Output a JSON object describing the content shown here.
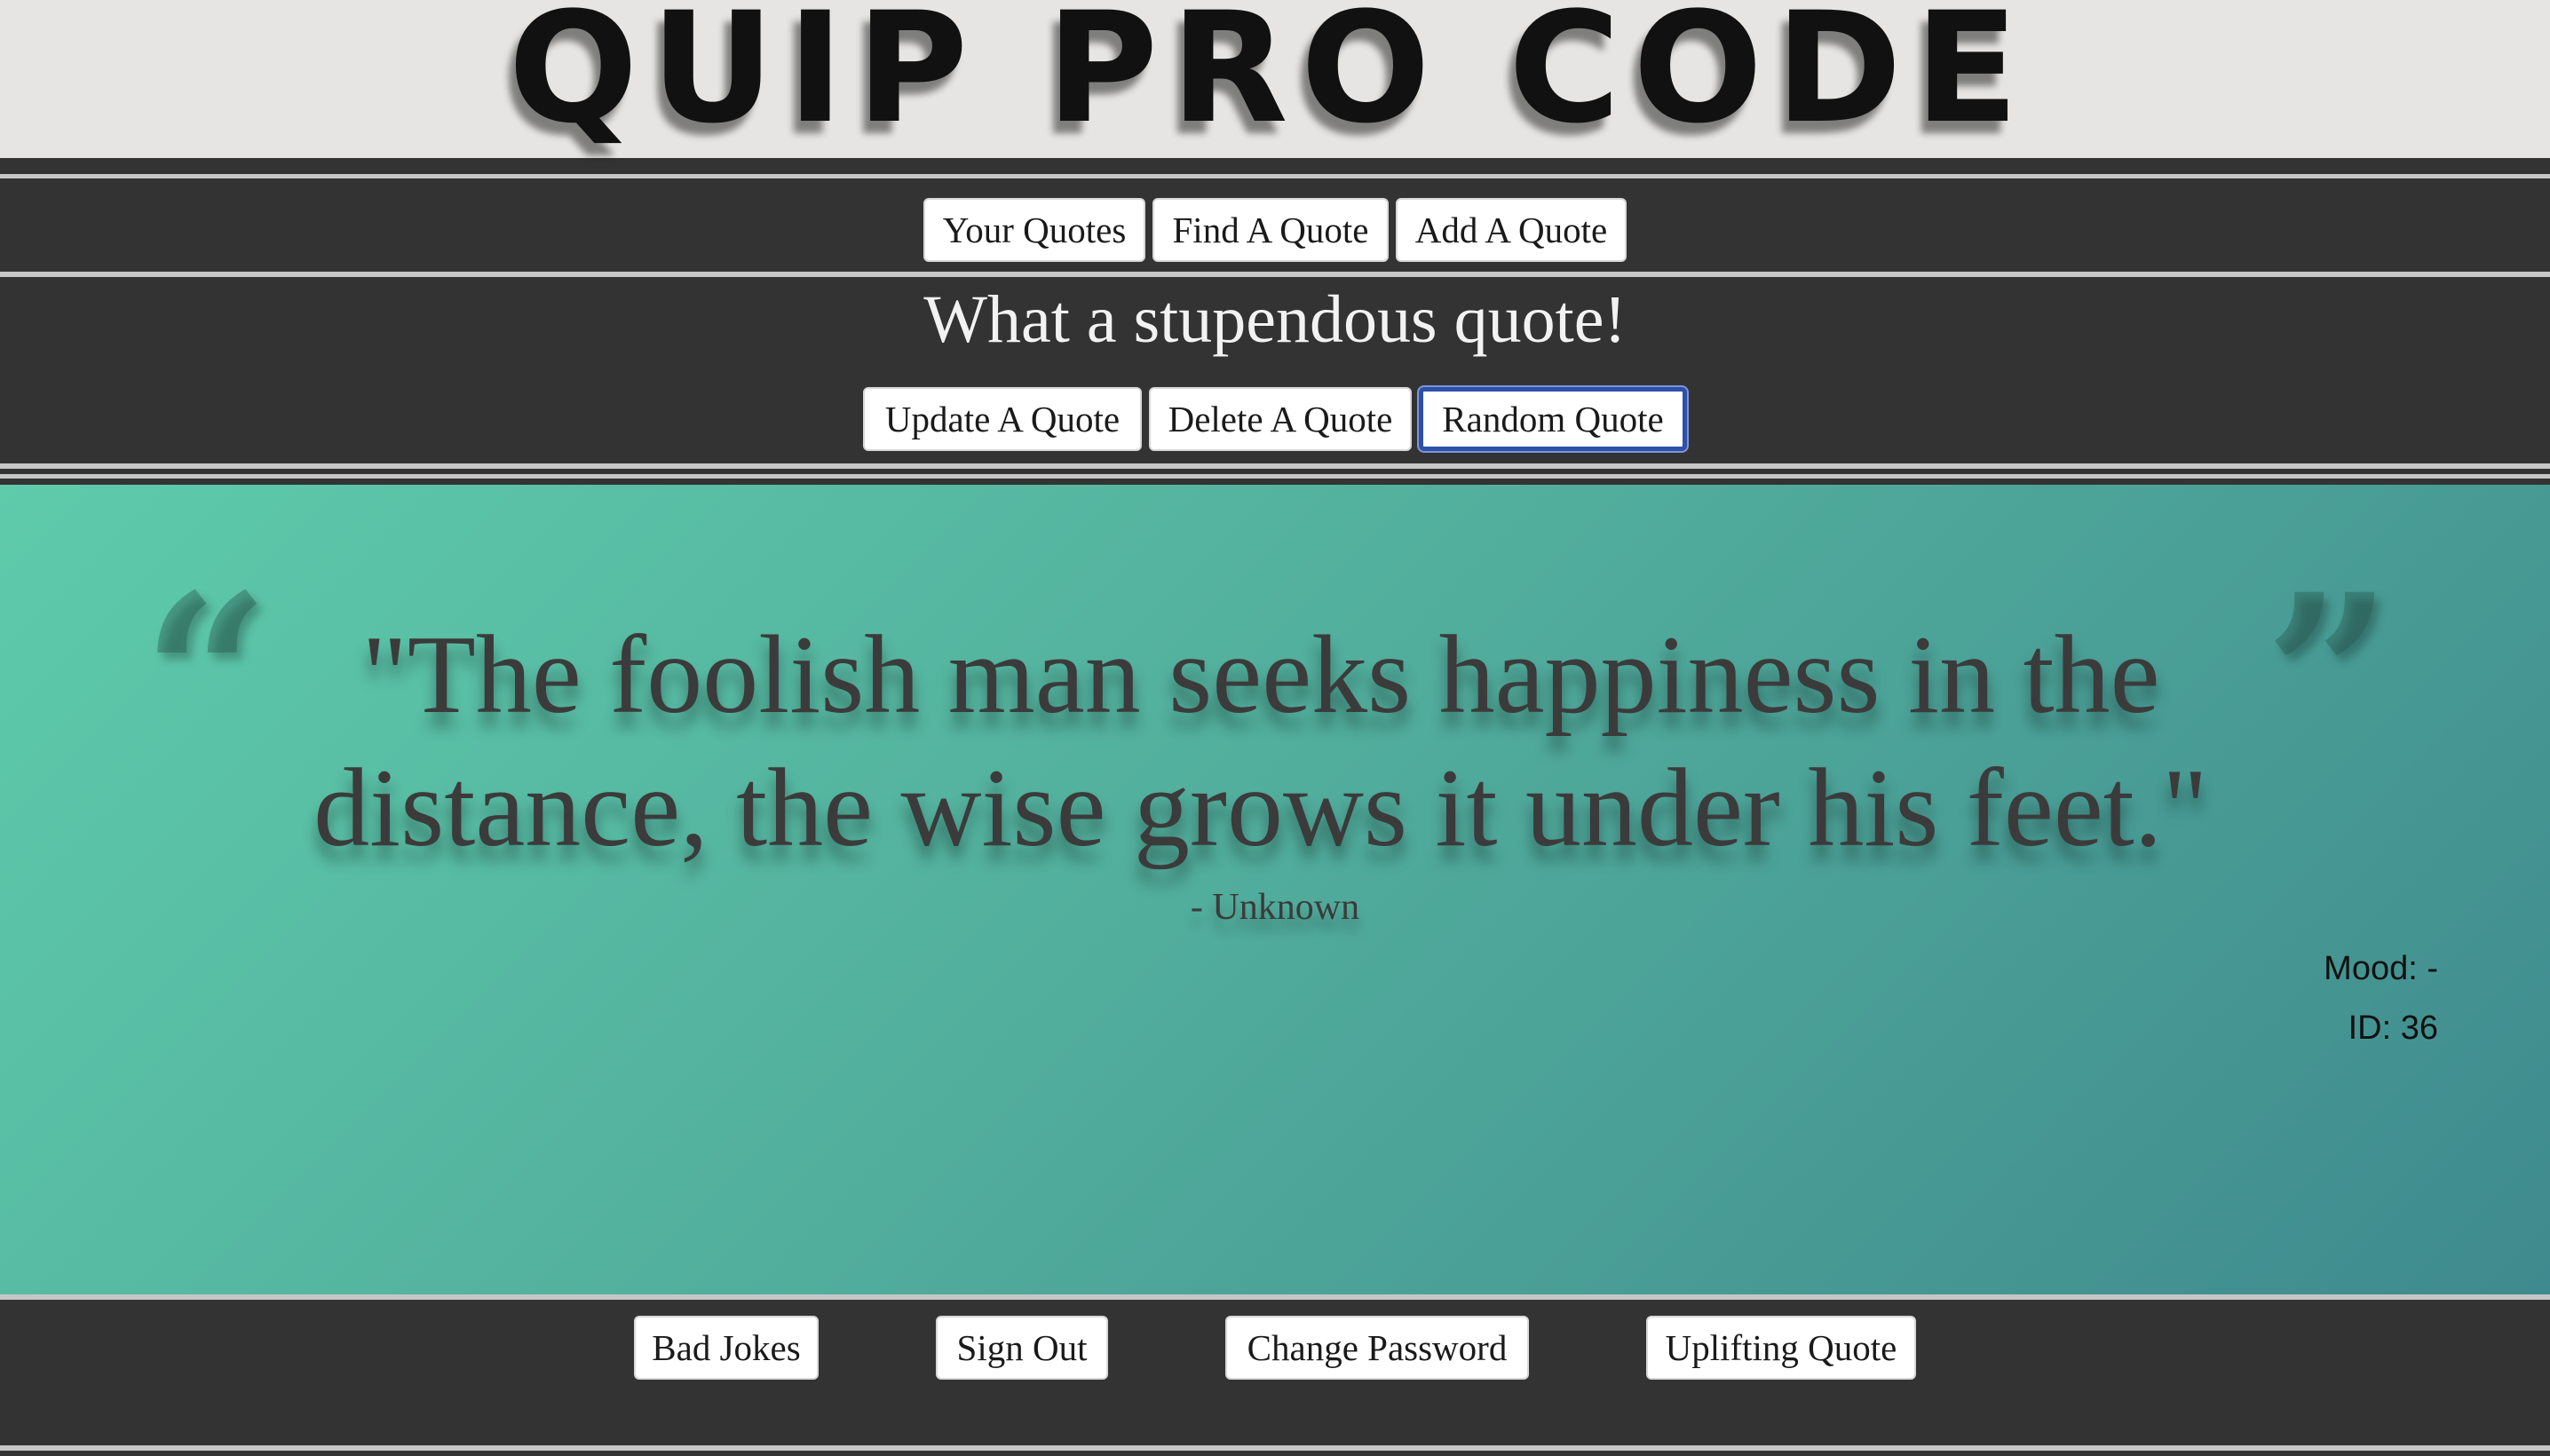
{
  "header": {
    "logo_text": "QUIP PRO CODE"
  },
  "nav": {
    "your_quotes": "Your Quotes",
    "find_quote": "Find A Quote",
    "add_quote": "Add A Quote"
  },
  "page": {
    "tagline": "What a stupendous quote!"
  },
  "actions": {
    "update_quote": "Update A Quote",
    "delete_quote": "Delete A Quote",
    "random_quote": "Random Quote"
  },
  "quote": {
    "open_mark": "“",
    "close_mark": "”",
    "text": "\"The foolish man seeks happiness in the distance, the wise grows it under his feet.\"",
    "author": "- Unknown",
    "mood_label": "Mood: -",
    "id_label": "ID: 36"
  },
  "footer": {
    "bad_jokes": "Bad Jokes",
    "sign_out": "Sign Out",
    "change_password": "Change Password",
    "uplifting_quote": "Uplifting Quote"
  },
  "colors": {
    "header_bg": "#e6e5e3",
    "band_bg": "#333333",
    "panel_gradient_start": "#5ecbab",
    "panel_gradient_end": "#3f8a8e",
    "focus_ring": "#2f4fa8"
  }
}
